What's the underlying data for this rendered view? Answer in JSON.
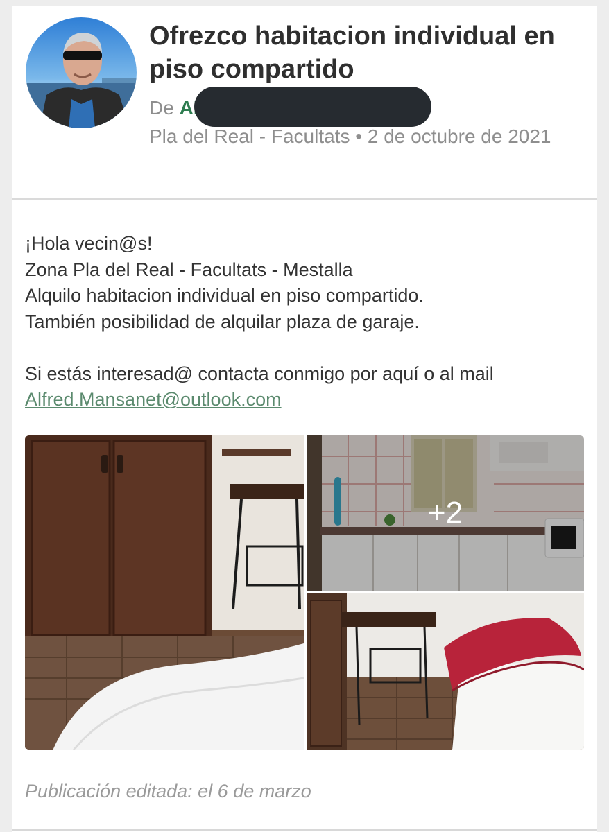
{
  "post": {
    "title": "Ofrezco habitacion individual en piso compartido",
    "author_prefix": "De",
    "author_name": "Al",
    "location": "Pla del Real - Facultats",
    "separator": " • ",
    "date": "2 de octubre de 2021",
    "body_lines": [
      "¡Hola vecin@s!",
      "Zona Pla del Real - Facultats - Mestalla",
      "Alquilo habitacion individual en piso compartido.",
      "También posibilidad de alquilar plaza de garaje."
    ],
    "contact_line": "Si estás interesad@ contacta conmigo por aquí o al mail",
    "email": "Alfred.Mansanet@outlook.com",
    "extra_photos_label": "+2",
    "edited_note": "Publicación editada: el 6 de marzo"
  },
  "icons": {
    "avatar": "profile-photo",
    "photos": [
      "bedroom-wardrobe-photo",
      "kitchen-photo",
      "bed-photo"
    ]
  }
}
